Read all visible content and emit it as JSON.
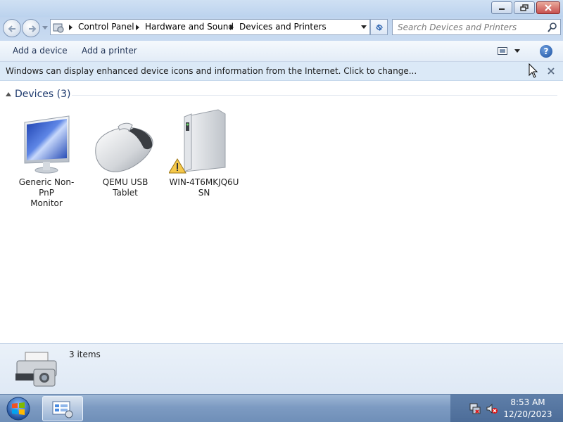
{
  "window": {
    "title": "",
    "controls": {
      "minimize": "minimize-icon",
      "restore": "restore-icon",
      "close": "close-icon"
    }
  },
  "nav": {
    "back_icon": "back-arrow-icon",
    "forward_icon": "forward-arrow-icon",
    "breadcrumbs": [
      "Control Panel",
      "Hardware and Sound",
      "Devices and Printers"
    ],
    "search_placeholder": "Search Devices and Printers"
  },
  "commandbar": {
    "add_device": "Add a device",
    "add_printer": "Add a printer"
  },
  "infobar": {
    "message": "Windows can display enhanced device icons and information from the Internet. Click to change..."
  },
  "group": {
    "title": "Devices (3)"
  },
  "devices": [
    {
      "name": "Generic Non-PnP Monitor",
      "icon": "monitor-icon",
      "warning": false
    },
    {
      "name": "QEMU USB Tablet",
      "icon": "mouse-icon",
      "warning": false
    },
    {
      "name": "WIN-4T6MKJQ6USN",
      "icon": "computer-tower-icon",
      "warning": true
    }
  ],
  "device_labels": [
    [
      "Generic Non-PnP",
      "Monitor"
    ],
    [
      "QEMU USB",
      "Tablet"
    ],
    [
      "WIN-4T6MKJQ6U",
      "SN"
    ]
  ],
  "details": {
    "count": "3 items"
  },
  "taskbar": {
    "time": "8:53 AM",
    "date": "12/20/2023"
  },
  "colors": {
    "accent": "#1e3a6e",
    "infobar": "#dbe9f7",
    "taskbar": "#7d9bc2"
  }
}
